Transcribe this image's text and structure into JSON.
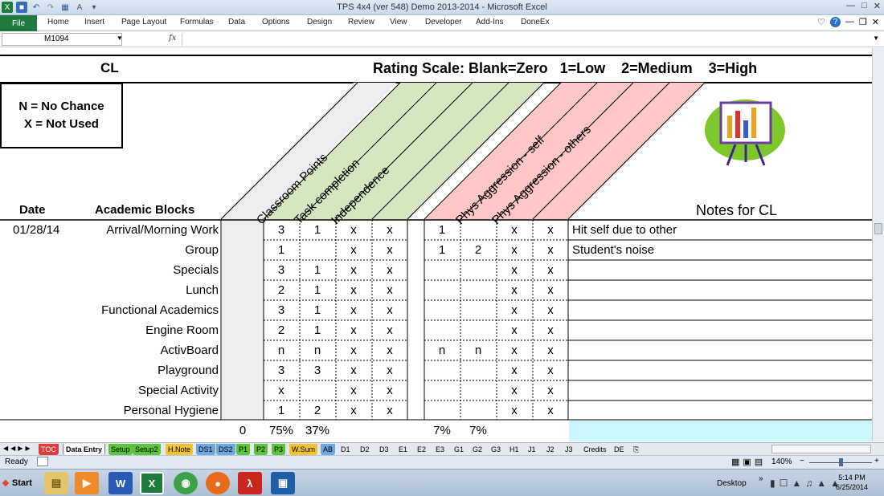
{
  "window": {
    "title": "TPS 4x4 (ver 548) Demo 2013-2014 - Microsoft Excel"
  },
  "ribbon": {
    "file": "File",
    "tabs": [
      "Home",
      "Insert",
      "Page Layout",
      "Formulas",
      "Data",
      "Options",
      "Design",
      "Review",
      "View",
      "Developer",
      "Add-Ins",
      "DoneEx"
    ]
  },
  "formula_bar": {
    "name_box": "M1094",
    "fx": "fx"
  },
  "sheet": {
    "student": "CL",
    "rating_scale": "Rating Scale: Blank=Zero   1=Low    2=Medium    3=High",
    "legend_line1": "N = No Chance",
    "legend_line2": "X = Not Used",
    "date_header": "Date",
    "blocks_header": "Academic Blocks",
    "notes_header": "Notes for CL",
    "diag_headers": [
      "Classroom Points",
      "Task completion",
      "Independence",
      "Phys Aggression - self",
      "Phys Aggression - others"
    ],
    "date": "01/28/14",
    "rows": [
      {
        "label": "Arrival/Morning Work",
        "c": [
          "3",
          "1",
          "x",
          "x",
          "1",
          "",
          "x",
          "x"
        ],
        "note": "Hit self due to other"
      },
      {
        "label": "Group",
        "c": [
          "1",
          "",
          "x",
          "x",
          "1",
          "2",
          "x",
          "x"
        ],
        "note": "Student's noise"
      },
      {
        "label": "Specials",
        "c": [
          "3",
          "1",
          "x",
          "x",
          "",
          "",
          "x",
          "x"
        ],
        "note": ""
      },
      {
        "label": "Lunch",
        "c": [
          "2",
          "1",
          "x",
          "x",
          "",
          "",
          "x",
          "x"
        ],
        "note": ""
      },
      {
        "label": "Functional Academics",
        "c": [
          "3",
          "1",
          "x",
          "x",
          "",
          "",
          "x",
          "x"
        ],
        "note": ""
      },
      {
        "label": "Engine Room",
        "c": [
          "2",
          "1",
          "x",
          "x",
          "",
          "",
          "x",
          "x"
        ],
        "note": ""
      },
      {
        "label": "ActivBoard",
        "c": [
          "n",
          "n",
          "x",
          "x",
          "n",
          "n",
          "x",
          "x"
        ],
        "note": ""
      },
      {
        "label": "Playground",
        "c": [
          "3",
          "3",
          "x",
          "x",
          "",
          "",
          "x",
          "x"
        ],
        "note": ""
      },
      {
        "label": "Special Activity",
        "c": [
          "x",
          "",
          "x",
          "x",
          "",
          "",
          "x",
          "x"
        ],
        "note": ""
      },
      {
        "label": "Personal Hygiene",
        "c": [
          "1",
          "2",
          "x",
          "x",
          "",
          "",
          "x",
          "x"
        ],
        "note": ""
      }
    ],
    "totals": [
      "0",
      "75%",
      "37%",
      "",
      "",
      "7%",
      "7%"
    ]
  },
  "sheet_tabs": [
    {
      "label": "TOC",
      "color": "#e23b3b"
    },
    {
      "label": "Data Entry",
      "color": "#ffffff"
    },
    {
      "label": "Setup",
      "color": "#5cc43a"
    },
    {
      "label": "Setup2",
      "color": "#5cc43a"
    },
    {
      "label": "H.Note",
      "color": "#f2c230"
    },
    {
      "label": "DS1",
      "color": "#6fa7e0"
    },
    {
      "label": "DS2",
      "color": "#6fa7e0"
    },
    {
      "label": "P1",
      "color": "#5cc43a"
    },
    {
      "label": "P2",
      "color": "#5cc43a"
    },
    {
      "label": "P3",
      "color": "#5cc43a"
    },
    {
      "label": "W.Sum",
      "color": "#f2c230"
    },
    {
      "label": "AB",
      "color": "#6fa7e0"
    },
    {
      "label": "D1",
      "color": "#e4e9f0"
    },
    {
      "label": "D2",
      "color": "#e4e9f0"
    },
    {
      "label": "D3",
      "color": "#e4e9f0"
    },
    {
      "label": "E1",
      "color": "#e4e9f0"
    },
    {
      "label": "E2",
      "color": "#e4e9f0"
    },
    {
      "label": "E3",
      "color": "#e4e9f0"
    },
    {
      "label": "G1",
      "color": "#e4e9f0"
    },
    {
      "label": "G2",
      "color": "#e4e9f0"
    },
    {
      "label": "G3",
      "color": "#e4e9f0"
    },
    {
      "label": "H1",
      "color": "#e4e9f0"
    },
    {
      "label": "J1",
      "color": "#e4e9f0"
    },
    {
      "label": "J2",
      "color": "#e4e9f0"
    },
    {
      "label": "J3",
      "color": "#e4e9f0"
    },
    {
      "label": "Credits",
      "color": "#e4e9f0"
    },
    {
      "label": "DE",
      "color": "#e4e9f0"
    }
  ],
  "status": {
    "ready": "Ready",
    "zoom": "140%"
  },
  "taskbar": {
    "start": "Start",
    "desktop": "Desktop",
    "time": "5:14 PM",
    "date": "6/25/2014"
  },
  "colors": {
    "gray_band": "#eeeeee",
    "green_band": "#d4e8bf",
    "pink_band": "#ffc7c7",
    "cyan_cell": "#c9f7fb",
    "excel_green": "#1f7a3d"
  }
}
